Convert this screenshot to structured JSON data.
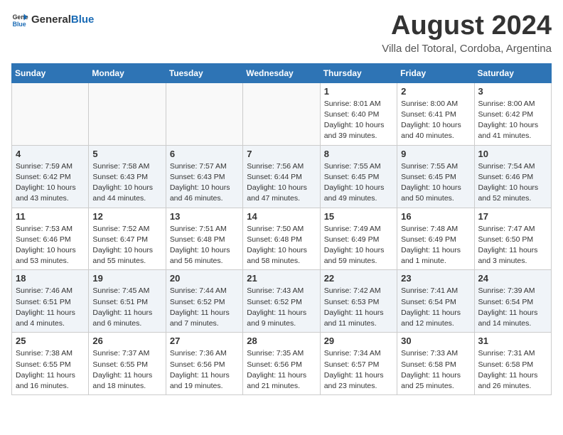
{
  "header": {
    "logo_general": "General",
    "logo_blue": "Blue",
    "month_title": "August 2024",
    "location": "Villa del Totoral, Cordoba, Argentina"
  },
  "days_of_week": [
    "Sunday",
    "Monday",
    "Tuesday",
    "Wednesday",
    "Thursday",
    "Friday",
    "Saturday"
  ],
  "weeks": [
    [
      {
        "day": "",
        "info": ""
      },
      {
        "day": "",
        "info": ""
      },
      {
        "day": "",
        "info": ""
      },
      {
        "day": "",
        "info": ""
      },
      {
        "day": "1",
        "info": "Sunrise: 8:01 AM\nSunset: 6:40 PM\nDaylight: 10 hours\nand 39 minutes."
      },
      {
        "day": "2",
        "info": "Sunrise: 8:00 AM\nSunset: 6:41 PM\nDaylight: 10 hours\nand 40 minutes."
      },
      {
        "day": "3",
        "info": "Sunrise: 8:00 AM\nSunset: 6:42 PM\nDaylight: 10 hours\nand 41 minutes."
      }
    ],
    [
      {
        "day": "4",
        "info": "Sunrise: 7:59 AM\nSunset: 6:42 PM\nDaylight: 10 hours\nand 43 minutes."
      },
      {
        "day": "5",
        "info": "Sunrise: 7:58 AM\nSunset: 6:43 PM\nDaylight: 10 hours\nand 44 minutes."
      },
      {
        "day": "6",
        "info": "Sunrise: 7:57 AM\nSunset: 6:43 PM\nDaylight: 10 hours\nand 46 minutes."
      },
      {
        "day": "7",
        "info": "Sunrise: 7:56 AM\nSunset: 6:44 PM\nDaylight: 10 hours\nand 47 minutes."
      },
      {
        "day": "8",
        "info": "Sunrise: 7:55 AM\nSunset: 6:45 PM\nDaylight: 10 hours\nand 49 minutes."
      },
      {
        "day": "9",
        "info": "Sunrise: 7:55 AM\nSunset: 6:45 PM\nDaylight: 10 hours\nand 50 minutes."
      },
      {
        "day": "10",
        "info": "Sunrise: 7:54 AM\nSunset: 6:46 PM\nDaylight: 10 hours\nand 52 minutes."
      }
    ],
    [
      {
        "day": "11",
        "info": "Sunrise: 7:53 AM\nSunset: 6:46 PM\nDaylight: 10 hours\nand 53 minutes."
      },
      {
        "day": "12",
        "info": "Sunrise: 7:52 AM\nSunset: 6:47 PM\nDaylight: 10 hours\nand 55 minutes."
      },
      {
        "day": "13",
        "info": "Sunrise: 7:51 AM\nSunset: 6:48 PM\nDaylight: 10 hours\nand 56 minutes."
      },
      {
        "day": "14",
        "info": "Sunrise: 7:50 AM\nSunset: 6:48 PM\nDaylight: 10 hours\nand 58 minutes."
      },
      {
        "day": "15",
        "info": "Sunrise: 7:49 AM\nSunset: 6:49 PM\nDaylight: 10 hours\nand 59 minutes."
      },
      {
        "day": "16",
        "info": "Sunrise: 7:48 AM\nSunset: 6:49 PM\nDaylight: 11 hours\nand 1 minute."
      },
      {
        "day": "17",
        "info": "Sunrise: 7:47 AM\nSunset: 6:50 PM\nDaylight: 11 hours\nand 3 minutes."
      }
    ],
    [
      {
        "day": "18",
        "info": "Sunrise: 7:46 AM\nSunset: 6:51 PM\nDaylight: 11 hours\nand 4 minutes."
      },
      {
        "day": "19",
        "info": "Sunrise: 7:45 AM\nSunset: 6:51 PM\nDaylight: 11 hours\nand 6 minutes."
      },
      {
        "day": "20",
        "info": "Sunrise: 7:44 AM\nSunset: 6:52 PM\nDaylight: 11 hours\nand 7 minutes."
      },
      {
        "day": "21",
        "info": "Sunrise: 7:43 AM\nSunset: 6:52 PM\nDaylight: 11 hours\nand 9 minutes."
      },
      {
        "day": "22",
        "info": "Sunrise: 7:42 AM\nSunset: 6:53 PM\nDaylight: 11 hours\nand 11 minutes."
      },
      {
        "day": "23",
        "info": "Sunrise: 7:41 AM\nSunset: 6:54 PM\nDaylight: 11 hours\nand 12 minutes."
      },
      {
        "day": "24",
        "info": "Sunrise: 7:39 AM\nSunset: 6:54 PM\nDaylight: 11 hours\nand 14 minutes."
      }
    ],
    [
      {
        "day": "25",
        "info": "Sunrise: 7:38 AM\nSunset: 6:55 PM\nDaylight: 11 hours\nand 16 minutes."
      },
      {
        "day": "26",
        "info": "Sunrise: 7:37 AM\nSunset: 6:55 PM\nDaylight: 11 hours\nand 18 minutes."
      },
      {
        "day": "27",
        "info": "Sunrise: 7:36 AM\nSunset: 6:56 PM\nDaylight: 11 hours\nand 19 minutes."
      },
      {
        "day": "28",
        "info": "Sunrise: 7:35 AM\nSunset: 6:56 PM\nDaylight: 11 hours\nand 21 minutes."
      },
      {
        "day": "29",
        "info": "Sunrise: 7:34 AM\nSunset: 6:57 PM\nDaylight: 11 hours\nand 23 minutes."
      },
      {
        "day": "30",
        "info": "Sunrise: 7:33 AM\nSunset: 6:58 PM\nDaylight: 11 hours\nand 25 minutes."
      },
      {
        "day": "31",
        "info": "Sunrise: 7:31 AM\nSunset: 6:58 PM\nDaylight: 11 hours\nand 26 minutes."
      }
    ]
  ]
}
